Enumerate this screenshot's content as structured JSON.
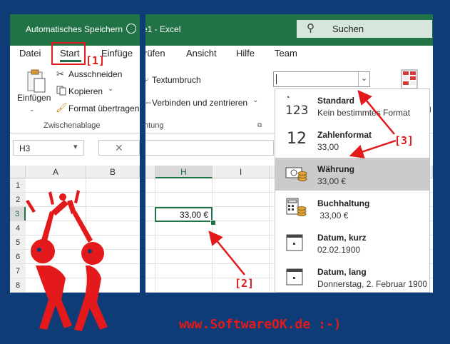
{
  "titlebar": {
    "autosave_label": "Automatisches Speichern",
    "doc_title": "e1 - Excel",
    "search_placeholder": "Suchen"
  },
  "tabs": [
    "Datei",
    "Start",
    "Einfüge",
    "rüfen",
    "Ansicht",
    "Hilfe",
    "Team"
  ],
  "clipboard": {
    "paste": "Einfügen",
    "cut": "Ausschneiden",
    "copy": "Kopieren",
    "format_painter": "Format übertragen",
    "group_label": "Zwischenablage"
  },
  "alignment": {
    "wrap_text": "Textumbruch",
    "merge_center": "Verbinden und zentrieren",
    "group_label_partial": "htung"
  },
  "namebox": {
    "value": "H3"
  },
  "columns_left": [
    "A",
    "B"
  ],
  "columns_right": [
    "H",
    "I"
  ],
  "rows": [
    "1",
    "2",
    "3",
    "4",
    "5",
    "6",
    "7",
    "8"
  ],
  "cell_h3": "33,00 €",
  "format_box": {
    "value": ""
  },
  "format_options": [
    {
      "title": "Standard",
      "sub": "Kein bestimmtes Format",
      "icon": "123"
    },
    {
      "title": "Zahlenformat",
      "sub": "33,00",
      "icon": "12"
    },
    {
      "title": "Währung",
      "sub": "33,00 €"
    },
    {
      "title": "Buchhaltung",
      "sub": " 33,00 €"
    },
    {
      "title": "Datum, kurz",
      "sub": "02.02.1900"
    },
    {
      "title": "Datum, lang",
      "sub": "Donnerstag, 2. Februar 1900"
    }
  ],
  "annotations": [
    "[1]",
    "[2]",
    "[3]"
  ],
  "watermark": "www.SoftwareOK.de :-)",
  "colors": {
    "excel_green": "#217346",
    "accent_red": "#e3191b",
    "background": "#0e3c76",
    "selected_row": "#cbcbcb"
  }
}
